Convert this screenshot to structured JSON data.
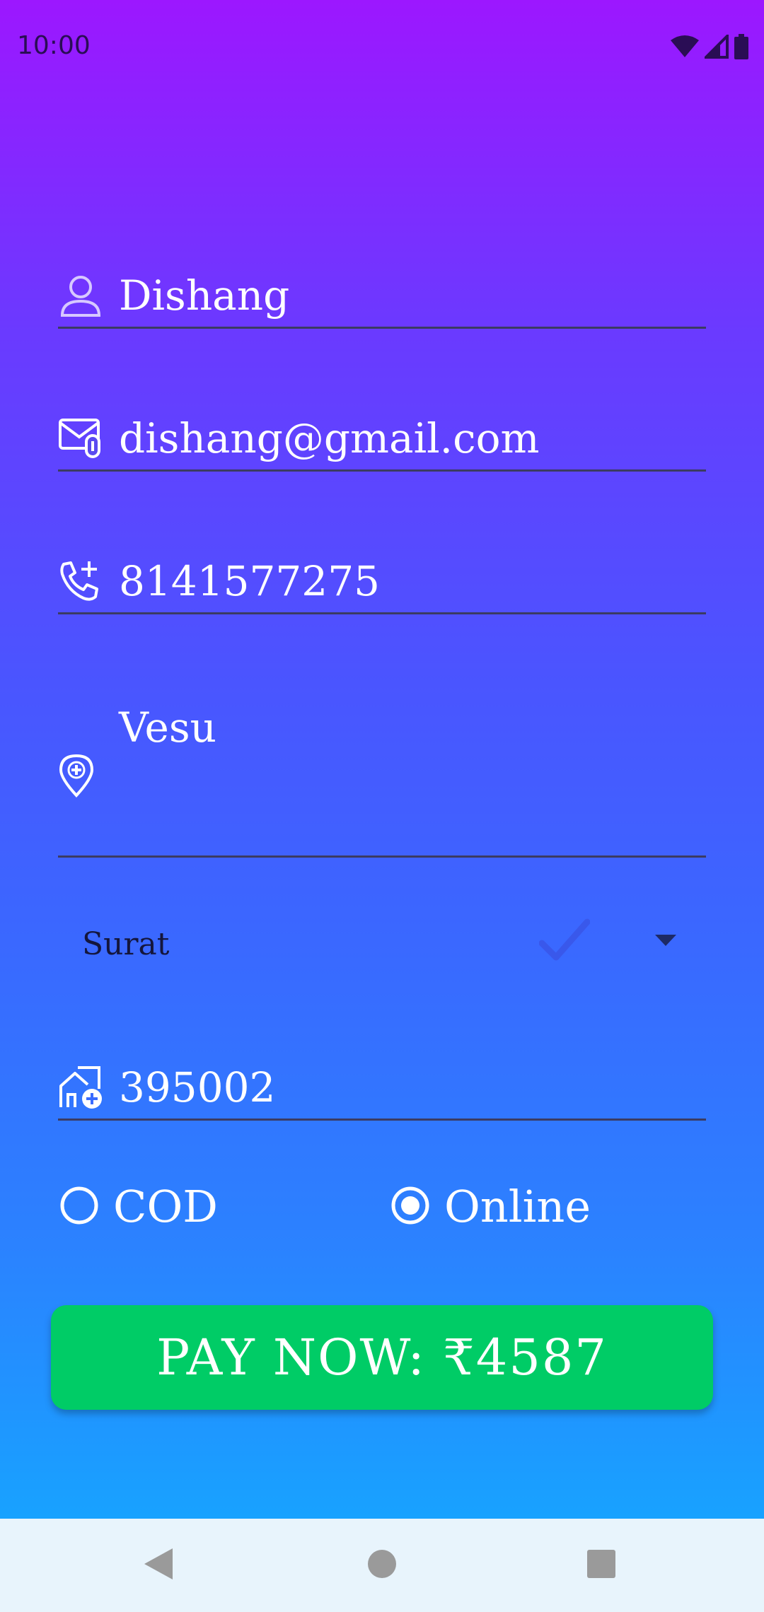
{
  "status_bar": {
    "time": "10:00",
    "icons": [
      "wifi-icon",
      "signal-icon",
      "battery-icon"
    ]
  },
  "form": {
    "name": {
      "value": "Dishang",
      "icon": "person-icon"
    },
    "email": {
      "value": "dishang@gmail.com",
      "icon": "mail-attachment-icon"
    },
    "phone": {
      "value": "8141577275",
      "icon": "phone-add-icon"
    },
    "address": {
      "value": "Vesu",
      "icon": "location-add-icon"
    },
    "city": {
      "selected": "Surat"
    },
    "pincode": {
      "value": "395002",
      "icon": "home-add-icon"
    }
  },
  "payment": {
    "options": [
      {
        "label": "COD",
        "selected": false
      },
      {
        "label": "Online",
        "selected": true
      }
    ]
  },
  "pay_button": {
    "label": "PAY NOW: ₹4587",
    "color": "#00cc66"
  },
  "nav": {
    "buttons": [
      "back-icon",
      "home-icon",
      "recents-icon"
    ]
  }
}
